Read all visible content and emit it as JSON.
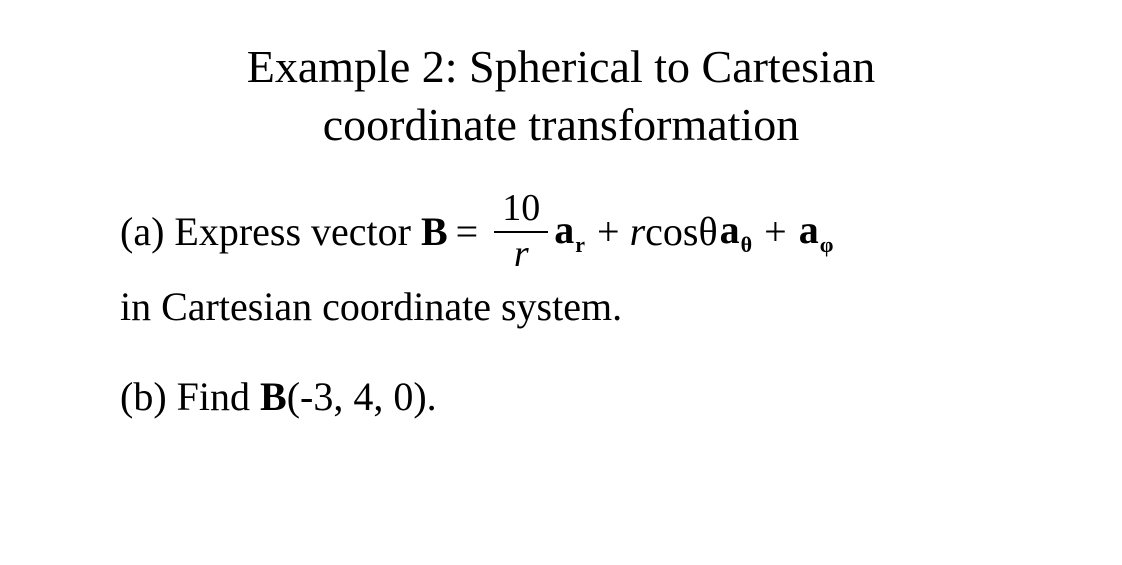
{
  "title": {
    "line1": "Example 2: Spherical to Cartesian",
    "line2": "coordinate transformation"
  },
  "partA": {
    "lead": "(a) Express vector",
    "B": "B",
    "eq": "=",
    "frac_num": "10",
    "frac_den": "r",
    "a": "a",
    "sub_r": "r",
    "plus": "+",
    "r": "r",
    "cos": "cos",
    "theta": "θ",
    "sub_theta": "θ",
    "sub_phi": "φ",
    "line2": "in Cartesian coordinate system."
  },
  "partB": {
    "lead": "(b) Find ",
    "B": "B",
    "args": "(-3, 4, 0)."
  }
}
